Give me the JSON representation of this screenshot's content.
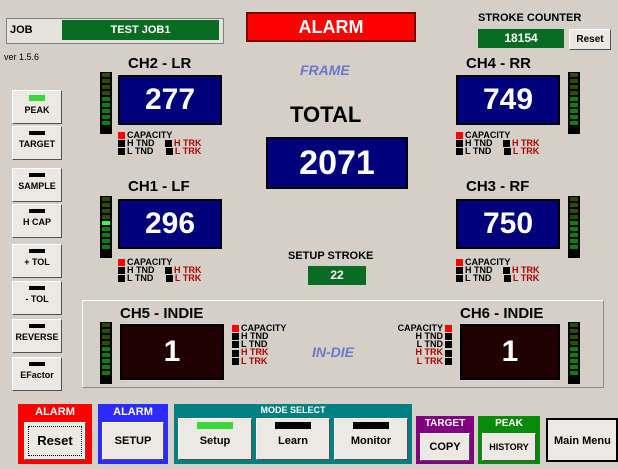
{
  "job": {
    "label": "JOB",
    "name": "TEST JOB1"
  },
  "version": "ver 1.5.6",
  "alarm_banner": "ALARM",
  "stroke_counter": {
    "label": "STROKE COUNTER",
    "value": "18154",
    "reset_label": "Reset"
  },
  "frame_label": "FRAME",
  "sidebar": [
    {
      "label": "PEAK",
      "active": true
    },
    {
      "label": "TARGET",
      "active": false
    },
    {
      "label": "SAMPLE",
      "active": false
    },
    {
      "label": "H CAP",
      "active": false
    },
    {
      "label": "+ TOL",
      "active": false
    },
    {
      "label": "- TOL",
      "active": false
    },
    {
      "label": "REVERSE",
      "active": false
    },
    {
      "label": "EFactor",
      "active": false
    }
  ],
  "legend": {
    "capacity": "CAPACITY",
    "h_tnd": "H TND",
    "l_tnd": "L TND",
    "h_trk": "H TRK",
    "l_trk": "L TRK"
  },
  "channels": {
    "ch2": {
      "title": "CH2 - LR",
      "value": "277"
    },
    "ch4": {
      "title": "CH4 - RR",
      "value": "749"
    },
    "ch1": {
      "title": "CH1 - LF",
      "value": "296"
    },
    "ch3": {
      "title": "CH3 - RF",
      "value": "750"
    },
    "ch5": {
      "title": "CH5 - INDIE",
      "value": "1"
    },
    "ch6": {
      "title": "CH6 - INDIE",
      "value": "1"
    }
  },
  "total": {
    "label": "TOTAL",
    "value": "2071"
  },
  "setup_stroke": {
    "label": "SETUP STROKE",
    "value": "22"
  },
  "indie_label": "IN-DIE",
  "bottom": {
    "alarm_reset": {
      "head": "ALARM",
      "label": "Reset"
    },
    "alarm_setup": {
      "head": "ALARM",
      "label": "SETUP"
    },
    "mode_select": {
      "head": "MODE SELECT",
      "setup": "Setup",
      "learn": "Learn",
      "monitor": "Monitor"
    },
    "target_copy": {
      "head": "TARGET",
      "label": "COPY"
    },
    "peak_history": {
      "head": "PEAK",
      "label": "HISTORY"
    },
    "main_menu": "Main Menu"
  },
  "colors": {
    "display_bg": "#00007a",
    "status_green": "#0a6b22",
    "alarm_red": "#ff0000"
  }
}
